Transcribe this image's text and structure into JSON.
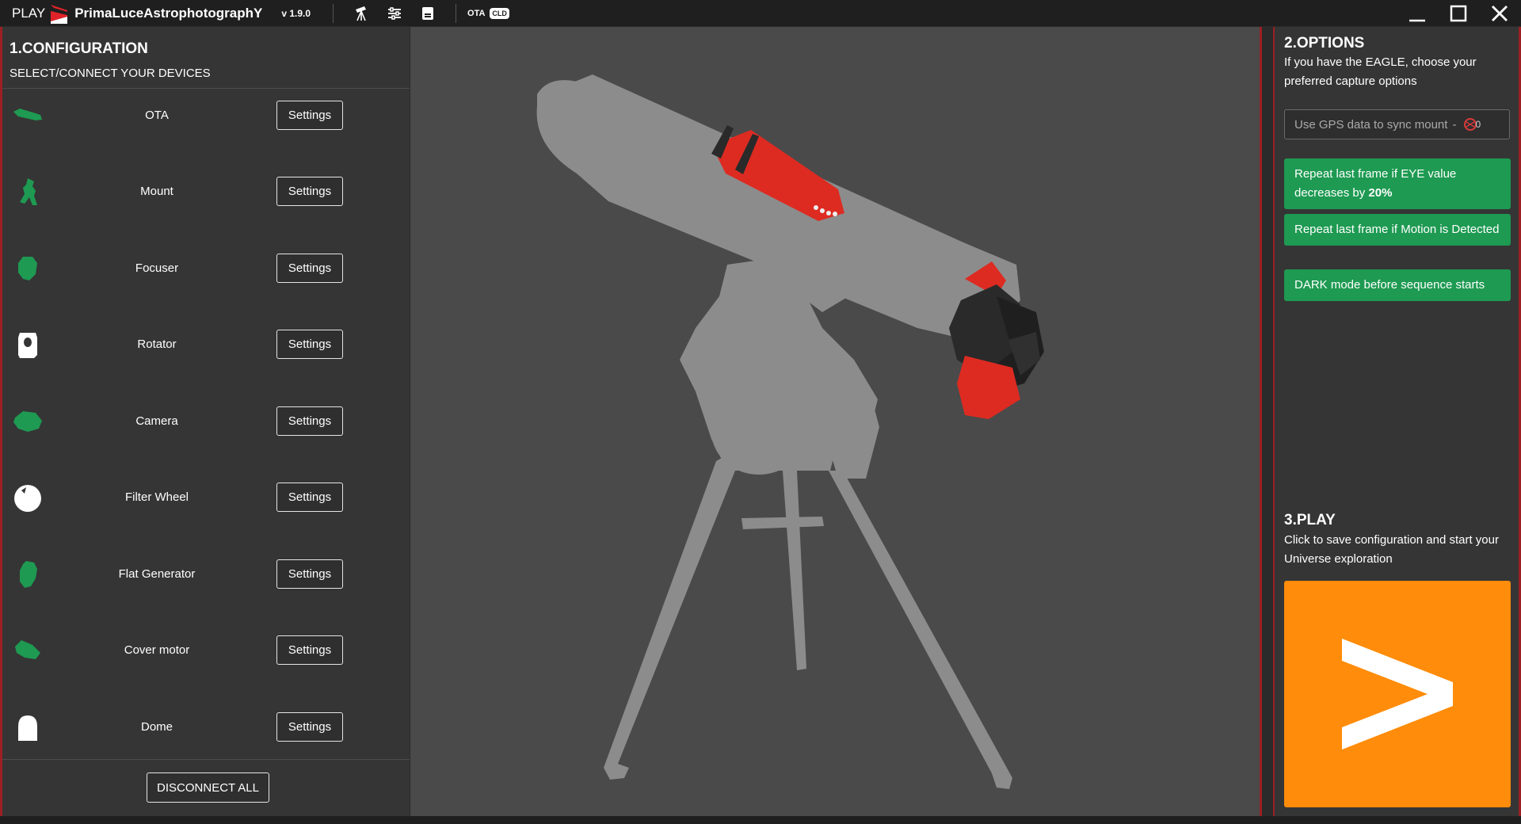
{
  "titlebar": {
    "app_prefix": "PLAY",
    "product_name": "PrimaLuceAstrophotographY",
    "version": "v 1.9.0",
    "ota_label": "OTA",
    "cld_badge": "CLD",
    "icons": [
      "telescope-icon",
      "sliders-icon",
      "document-icon"
    ]
  },
  "configuration": {
    "title": "1.CONFIGURATION",
    "subtitle": "SELECT/CONNECT YOUR DEVICES",
    "devices": [
      {
        "name": "OTA",
        "icon": "ota-icon",
        "status_color": "#1e9a52"
      },
      {
        "name": "Mount",
        "icon": "mount-icon",
        "status_color": "#1e9a52"
      },
      {
        "name": "Focuser",
        "icon": "focuser-icon",
        "status_color": "#1e9a52"
      },
      {
        "name": "Rotator",
        "icon": "rotator-icon",
        "status_color": "#ffffff"
      },
      {
        "name": "Camera",
        "icon": "camera-icon",
        "status_color": "#1e9a52"
      },
      {
        "name": "Filter Wheel",
        "icon": "filter-wheel-icon",
        "status_color": "#ffffff"
      },
      {
        "name": "Flat Generator",
        "icon": "flat-generator-icon",
        "status_color": "#1e9a52"
      },
      {
        "name": "Cover motor",
        "icon": "cover-motor-icon",
        "status_color": "#1e9a52"
      },
      {
        "name": "Dome",
        "icon": "dome-icon",
        "status_color": "#ffffff"
      }
    ],
    "settings_label": "Settings",
    "disconnect_label": "DISCONNECT ALL"
  },
  "options": {
    "title": "2.OPTIONS",
    "description": "If you have the EAGLE, choose your preferred capture options",
    "gps_field": {
      "text": "Use GPS data to sync mount",
      "separator": "-",
      "badge_count": "0"
    },
    "buttons": [
      {
        "text_plain": "Repeat last frame if EYE value decreases by ",
        "text_bold": "20%"
      },
      {
        "text_plain": "Repeat last frame if Motion is Detected",
        "text_bold": ""
      },
      {
        "text_plain": "DARK mode before sequence starts",
        "text_bold": ""
      }
    ]
  },
  "play": {
    "title": "3.PLAY",
    "description": "Click to save configuration and start your Universe exploration",
    "button_icon": "play-chevron-icon"
  },
  "colors": {
    "accent_red": "#9c1f24",
    "connected_green": "#1e9a52",
    "play_orange": "#ff8c0a",
    "panel_bg": "#353535",
    "viewport_bg": "#4a4a4a"
  }
}
